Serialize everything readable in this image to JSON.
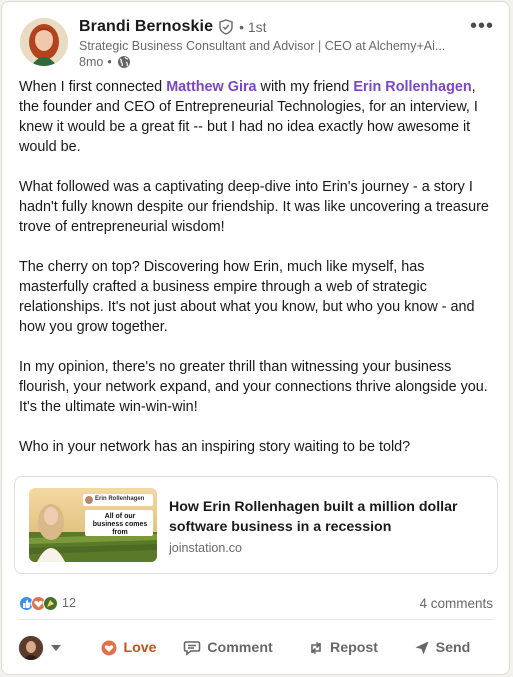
{
  "author": {
    "name": "Brandi Bernoskie",
    "degree": "1st",
    "headline": "Strategic Business Consultant and Advisor | CEO at Alchemy+Ai...",
    "time": "8mo"
  },
  "post": {
    "p1_before": "When I first connected ",
    "mention1": "Matthew Gira",
    "p1_mid": " with my friend ",
    "mention2": "Erin Rollenhagen",
    "p1_after": ", the founder and CEO of Entrepreneurial Technologies, for an interview, I knew it would be a great fit -- but I had no idea exactly how awesome it would be.",
    "p2": "What followed was a captivating deep-dive into Erin's journey - a story I hadn't fully known despite our friendship. It was like uncovering a treasure trove of entrepreneurial wisdom!",
    "p3": "The cherry on top? Discovering how Erin, much like myself, has masterfully crafted a business empire through a web of strategic relationships. It's not just about what you know, but who you know - and how you grow together.",
    "p4": "In my opinion, there's no greater thrill than witnessing your business flourish, your network expand, and your connections thrive alongside you. It's the ultimate win-win-win!",
    "p5": "Who in your network has an inspiring story waiting to be told?"
  },
  "link_preview": {
    "title": "How Erin Rollenhagen built a million dollar software business in a recession",
    "domain": "joinstation.co",
    "thumb_name": "Erin Rollenhagen",
    "thumb_caption": "All of our business comes from"
  },
  "social": {
    "reaction_count": "12",
    "comments": "4 comments"
  },
  "actions": {
    "love": "Love",
    "comment": "Comment",
    "repost": "Repost",
    "send": "Send"
  },
  "colors": {
    "mention": "#7a46c7",
    "love": "#c0521e",
    "like": "#378fe9",
    "celebrate": "#44712e"
  }
}
